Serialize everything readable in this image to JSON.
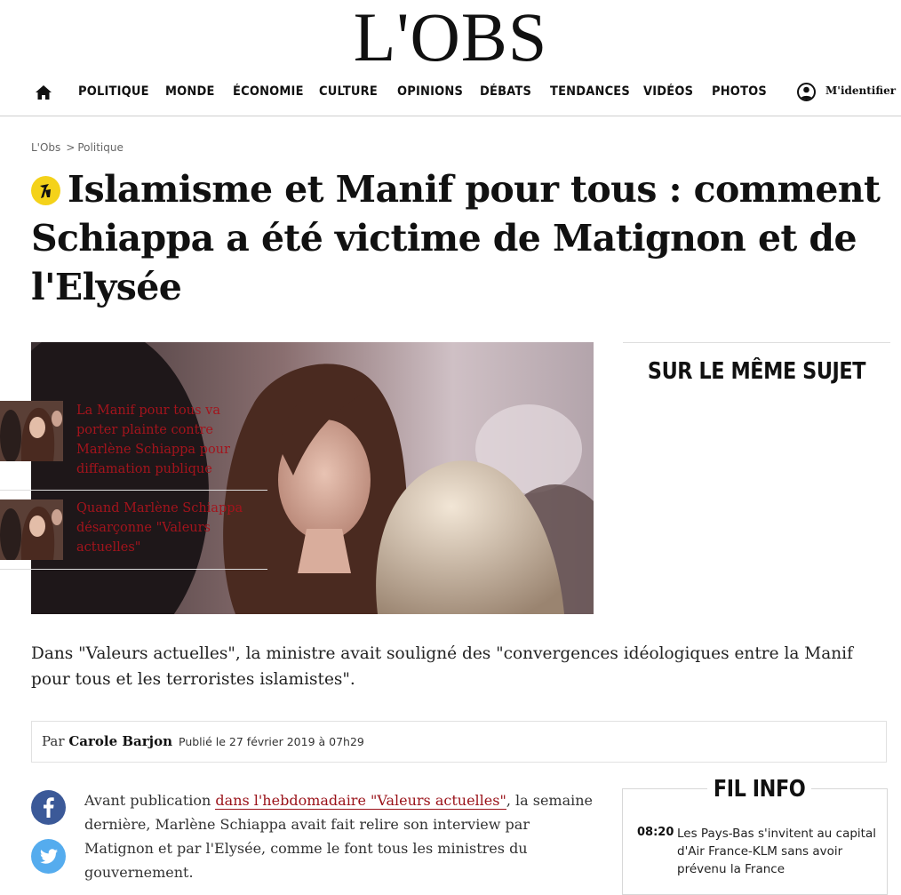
{
  "site": {
    "logo": "L'OBS"
  },
  "nav": {
    "items": [
      "POLITIQUE",
      "MONDE",
      "ÉCONOMIE",
      "CULTURE",
      "OPINIONS",
      "DÉBATS",
      "TENDANCES",
      "VIDÉOS",
      "PHOTOS"
    ],
    "login_label": "M'identifier"
  },
  "breadcrumb": {
    "home": "L'Obs",
    "separator": ">",
    "section": "Politique"
  },
  "article": {
    "title": "Islamisme et Manif pour tous : comment Schiappa a été victime de Matignon et de l'Elysée",
    "lede": "Dans \"Valeurs actuelles\", la ministre avait souligné des \"convergences idéologiques entre la Manif pour tous et les terroristes islamistes\".",
    "byline_prefix": "Par",
    "author": "Carole Barjon",
    "published": "Publié le 27 février 2019 à 07h29",
    "body_before_link": "Avant publication ",
    "body_link": "dans l'hebdomadaire \"Valeurs actuelles\"",
    "body_after_link": ", la semaine dernière, Marlène Schiappa avait fait relire son interview par Matignon et par l'Elysée, comme le font tous les ministres du gouvernement."
  },
  "sidebar": {
    "title": "SUR LE MÊME SUJET",
    "related": [
      {
        "title": "La Manif pour tous va porter plainte contre Marlène Schiappa pour diffamation publique"
      },
      {
        "title": "Quand Marlène Schiappa désarçonne \"Valeurs actuelles\""
      }
    ]
  },
  "fil_info": {
    "title": "FIL INFO",
    "items": [
      {
        "time": "08:20",
        "text": "Les Pays-Bas s'invitent au capital d'Air France-KLM sans avoir prévenu la France"
      }
    ]
  },
  "colors": {
    "link": "#a3141c",
    "badge": "#f4d21a",
    "facebook": "#3b5998",
    "twitter": "#55acee"
  },
  "icons": {
    "home": "home-icon",
    "user": "user-icon",
    "premium": "premium-badge-icon",
    "facebook": "facebook-icon",
    "twitter": "twitter-icon"
  }
}
